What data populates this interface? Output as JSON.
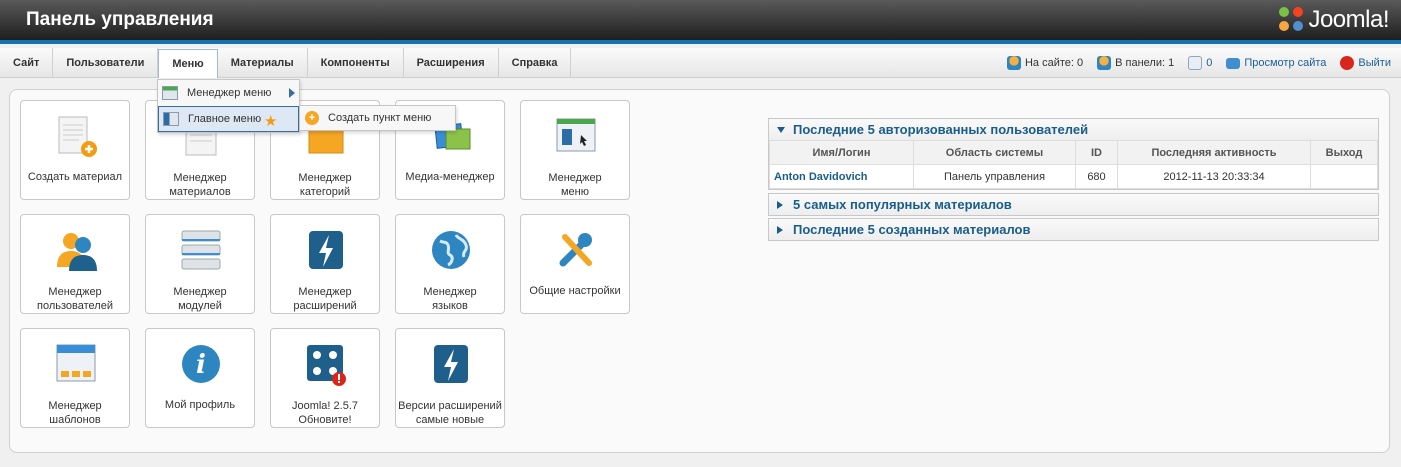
{
  "header": {
    "title": "Панель управления",
    "logo_text": "Joomla!"
  },
  "menu": {
    "items": [
      "Сайт",
      "Пользователи",
      "Меню",
      "Материалы",
      "Компоненты",
      "Расширения",
      "Справка"
    ]
  },
  "status": {
    "online_label": "На сайте: 0",
    "admin_label": "В панели: 1",
    "messages": "0",
    "view_site": "Просмотр сайта",
    "logout": "Выйти"
  },
  "dropdown": {
    "menu_manager": "Менеджер меню",
    "main_menu": "Главное меню",
    "add_item": "Создать пункт меню"
  },
  "tiles": [
    {
      "lines": [
        "Создать материал"
      ]
    },
    {
      "lines": [
        "Менеджер",
        "материалов"
      ]
    },
    {
      "lines": [
        "Менеджер",
        "категорий"
      ]
    },
    {
      "lines": [
        "Медиа-менеджер"
      ]
    },
    {
      "lines": [
        "Менеджер",
        "меню"
      ]
    },
    {
      "lines": [
        "Менеджер",
        "пользователей"
      ]
    },
    {
      "lines": [
        "Менеджер",
        "модулей"
      ]
    },
    {
      "lines": [
        "Менеджер",
        "расширений"
      ]
    },
    {
      "lines": [
        "Менеджер",
        "языков"
      ]
    },
    {
      "lines": [
        "Общие настройки"
      ]
    },
    {
      "lines": [
        "Менеджер",
        "шаблонов"
      ]
    },
    {
      "lines": [
        "Мой профиль"
      ]
    },
    {
      "lines": [
        "Joomla! 2.5.7",
        "Обновите!"
      ]
    },
    {
      "lines": [
        "Версии расширений",
        "самые новые"
      ]
    }
  ],
  "modules": {
    "logged": {
      "title": "Последние 5 авторизованных пользователей",
      "columns": [
        "Имя/Логин",
        "Область системы",
        "ID",
        "Последняя активность",
        "Выход"
      ],
      "rows": [
        {
          "name": "Anton Davidovich",
          "area": "Панель управления",
          "id": "680",
          "last": "2012-11-13 20:33:34",
          "logout": ""
        }
      ]
    },
    "popular": {
      "title": "5 самых популярных материалов"
    },
    "latest": {
      "title": "Последние 5 созданных материалов"
    }
  },
  "colors": {
    "accent": "#1773b0",
    "link": "#1a5d8a"
  }
}
